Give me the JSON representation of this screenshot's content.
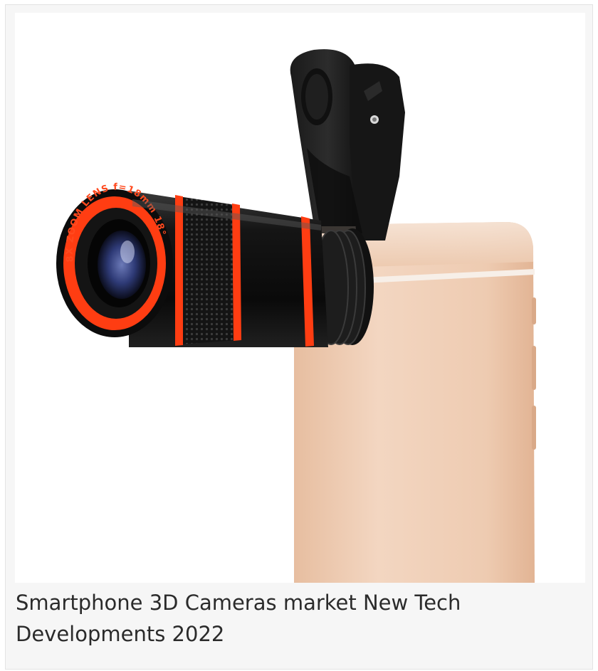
{
  "product_image": {
    "alt": "smartphone-telephoto-lens-product-image",
    "lens_ring_text": "8X ZOOM LENS f=18mm 18°",
    "colors": {
      "lens_body": "#111111",
      "accent_ring": "#ff3d12",
      "phone_body": "#ecc8ad",
      "lens_glass": "#3b4a8a"
    }
  },
  "caption": {
    "text": "Smartphone 3D Cameras market New Tech Developments 2022"
  }
}
